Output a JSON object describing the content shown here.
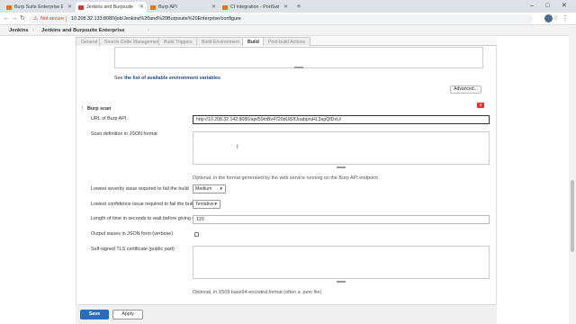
{
  "browser": {
    "tabs": [
      {
        "label": "Burp Suite Enterprise Edition",
        "color": "#e8711c",
        "active": false
      },
      {
        "label": "Jenkins and Burpsuite Ent...",
        "color": "#d33833",
        "active": true
      },
      {
        "label": "Burp API",
        "color": "#e8711c",
        "active": false
      },
      {
        "label": "CI integration - PortSwigg...",
        "color": "#e8711c",
        "active": false
      }
    ],
    "new_tab": "+",
    "not_secure": "Not secure",
    "url": "10.208.32.133:8080/job/Jenkins%20and%20Burpsuite%20Enterprise/configure",
    "min": "–",
    "max": "□",
    "close": "✕"
  },
  "breadcrumb": {
    "root": "Jenkins",
    "job": "Jenkins and Burpsuite Enterprise"
  },
  "config_tabs": [
    "General",
    "Source Code Management",
    "Build Triggers",
    "Build Environment",
    "Build",
    "Post-build Actions"
  ],
  "active_tab": "Build",
  "env_vars": {
    "see_text": "See",
    "link_text": "the list of available environment variables",
    "advanced_button": "Advanced..."
  },
  "burp_scan": {
    "section_title": "Burp scan",
    "delete_badge": "X",
    "url_label": "URL of Burp API",
    "url_value": "http://10.208.32.142:8080/api/59mBv4720dU82fJuabprsHL3apQfDxU/",
    "json_label": "Scan definition in JSON format",
    "json_help": "Optional, in the format generated by the web service running on the Burp API endpoint",
    "severity_label": "Lowest severity issue required to fail the build",
    "severity_value": "Medium",
    "confidence_label": "Lowest confidence issue required to fail the build",
    "confidence_value": "Tentative",
    "wait_label": "Length of time in seconds to wait before giving up",
    "wait_value": "120",
    "verbose_label": "Output issues in JSON form (verbose)",
    "cert_label": "Self-signed TLS certificate (public part)",
    "cert_help": "Optional, in X509 base64-encoded format (often a .pem file)"
  },
  "footer": {
    "save": "Save",
    "apply": "Apply"
  }
}
